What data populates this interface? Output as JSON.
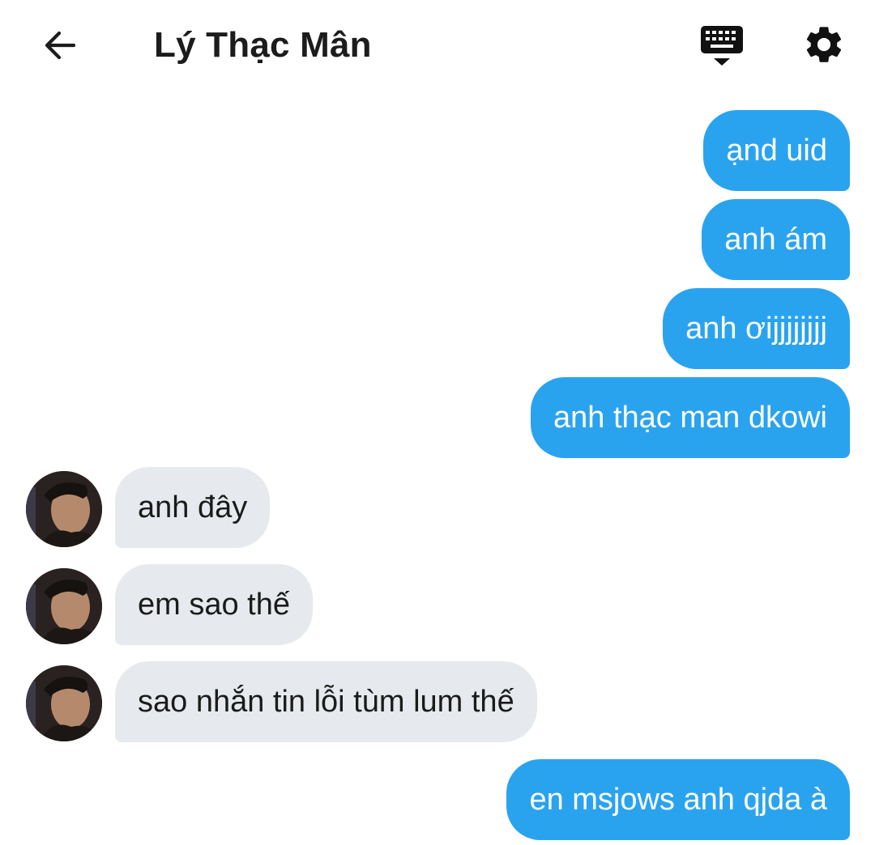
{
  "header": {
    "title": "Lý Thạc Mân",
    "back_icon": "arrow-left-icon",
    "keyboard_icon": "keyboard-hide-icon",
    "settings_icon": "gear-icon"
  },
  "colors": {
    "outgoing_bubble": "#2aa3ef",
    "incoming_bubble": "#e6eaee",
    "text_dark": "#1b1b1b"
  },
  "messages": [
    {
      "direction": "out",
      "text": "ạnd uid"
    },
    {
      "direction": "out",
      "text": "anh ám"
    },
    {
      "direction": "out",
      "text": "anh ơijjjjjjjj"
    },
    {
      "direction": "out",
      "text": "anh thạc man dkowi"
    },
    {
      "direction": "in",
      "text": "anh đây"
    },
    {
      "direction": "in",
      "text": "em sao thế"
    },
    {
      "direction": "in",
      "text": "sao nhắn tin lỗi tùm lum thế"
    },
    {
      "direction": "out",
      "text": "en msjows anh qjda à"
    }
  ]
}
